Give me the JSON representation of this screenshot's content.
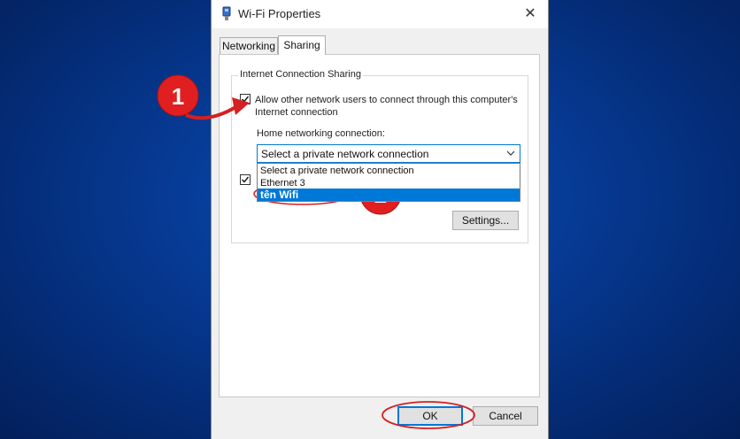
{
  "window": {
    "title": "Wi-Fi Properties",
    "close_glyph": "✕"
  },
  "tabs": [
    {
      "label": "Networking",
      "active": false
    },
    {
      "label": "Sharing",
      "active": true
    }
  ],
  "sharing": {
    "group_label": "Internet Connection Sharing",
    "allow_checkbox": {
      "checked": true,
      "label": "Allow other network users to connect through this computer's Internet connection"
    },
    "home_networking_label": "Home networking connection:",
    "select_value": "Select a private network connection",
    "dropdown_options": [
      "Select a private network connection",
      "Ethernet 3",
      "tên Wifi"
    ],
    "selected_option_index": 2,
    "control_checkbox": {
      "checked": true
    },
    "settings_label": "Settings..."
  },
  "footer": {
    "ok_label": "OK",
    "cancel_label": "Cancel"
  },
  "annotations": {
    "badge1": "1",
    "badge2": "2",
    "badge_color": "#e02020",
    "marker_color": "#d42020"
  },
  "colors": {
    "accent": "#0078d7",
    "background": "#063a94"
  }
}
